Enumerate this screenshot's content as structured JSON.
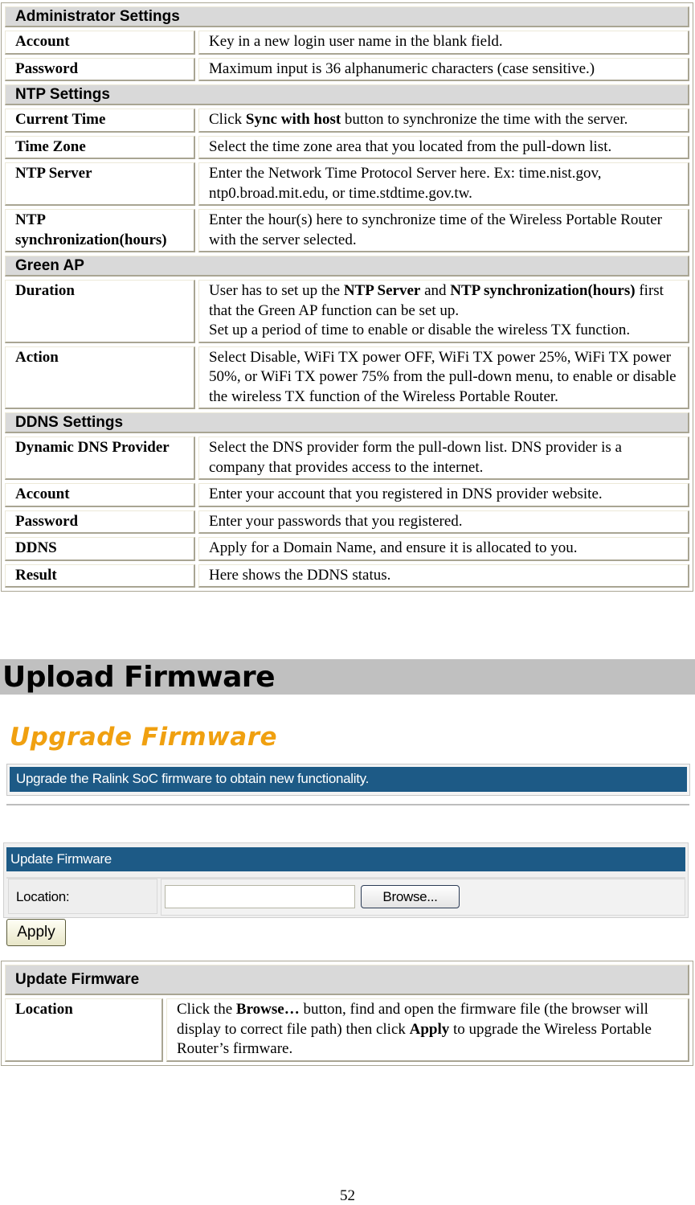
{
  "settings_table": {
    "sections": [
      {
        "title": "Administrator Settings",
        "rows": [
          {
            "label": "Account",
            "desc": "Key in a new login user name in the blank field."
          },
          {
            "label": "Password",
            "desc": "Maximum input is 36 alphanumeric characters (case sensitive.)"
          }
        ]
      },
      {
        "title": "NTP Settings",
        "rows": [
          {
            "label": "Current Time",
            "desc_parts": [
              "Click ",
              "Sync with host",
              " button to synchronize the time with the server."
            ]
          },
          {
            "label": "Time Zone",
            "desc": "Select the time zone area that you located from the pull-down list."
          },
          {
            "label": "NTP Server",
            "desc": "Enter the Network Time Protocol Server here. Ex: time.nist.gov, ntp0.broad.mit.edu, or time.stdtime.gov.tw."
          },
          {
            "label": "NTP synchronization(hours)",
            "desc": "Enter the hour(s) here to synchronize time of the Wireless Portable Router with the server selected."
          }
        ]
      },
      {
        "title": "Green AP",
        "rows": [
          {
            "label": "Duration",
            "desc_parts": [
              "User has to set up the ",
              "NTP Server",
              " and ",
              "NTP synchronization(hours)",
              " first that the Green AP function can be set up.",
              "Set up a period of time to enable or disable the wireless TX function."
            ]
          },
          {
            "label": "Action",
            "desc": "Select Disable, WiFi TX power OFF, WiFi TX power 25%, WiFi TX power 50%, or WiFi TX power 75% from the pull-down menu, to enable or disable the wireless TX function of the Wireless Portable Router."
          }
        ]
      },
      {
        "title": "DDNS Settings",
        "rows": [
          {
            "label": "Dynamic DNS Provider",
            "desc": "Select the DNS provider form the pull-down list. DNS provider is a company that provides access to the internet."
          },
          {
            "label": "Account",
            "desc": "Enter your account that you registered in DNS provider website."
          },
          {
            "label": "Password",
            "desc": "Enter your passwords that you registered."
          },
          {
            "label": "DDNS",
            "desc": "Apply for a Domain Name, and ensure it is allocated to you."
          },
          {
            "label": "Result",
            "desc": "Here shows the DDNS status."
          }
        ]
      }
    ]
  },
  "heading": "Upload Firmware",
  "screenshot": {
    "title": "Upgrade Firmware",
    "description": "Upgrade the Ralink SoC firmware to obtain new functionality.",
    "panel_title": "Update Firmware",
    "location_label": "Location:",
    "location_value": "",
    "browse_label": "Browse...",
    "apply_label": "Apply",
    "colors": {
      "title": "#f0a010",
      "bar": "#1d5a86"
    }
  },
  "firmware_table": {
    "title": "Update Firmware",
    "rows": [
      {
        "label": "Location",
        "desc_parts": [
          "Click the ",
          "Browse…",
          " button, find and open the firmware file (the browser will display to correct file path) then click ",
          "Apply",
          " to upgrade the Wireless Portable Router’s firmware."
        ]
      }
    ]
  },
  "page_number": "52"
}
